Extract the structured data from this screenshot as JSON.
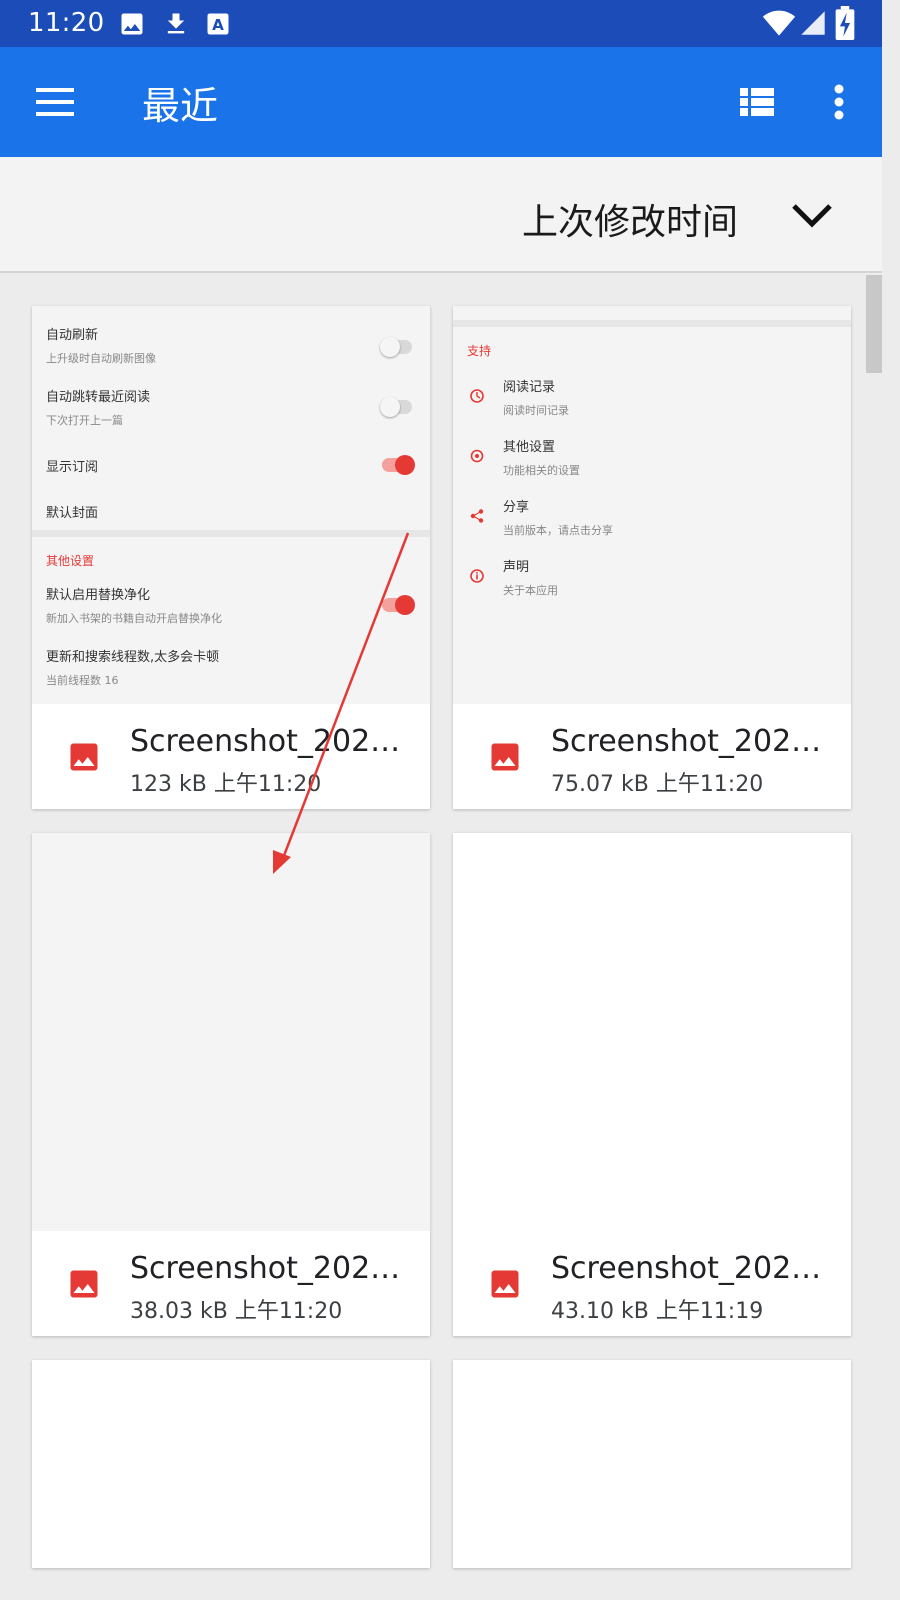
{
  "status_bar": {
    "time": "11:20",
    "left_icons": [
      "image-icon",
      "download-icon",
      "keyboard-a-icon"
    ],
    "right_icons": [
      "wifi-icon",
      "signal-icon",
      "battery-charging-icon"
    ]
  },
  "app_bar": {
    "title": "最近",
    "menu_icon": "hamburger-menu-icon",
    "view_icon": "list-view-icon",
    "more_icon": "more-vert-icon",
    "color": "#1a73e8"
  },
  "sort": {
    "label": "上次修改时间",
    "icon": "chevron-down-icon"
  },
  "files": [
    {
      "name": "Screenshot_2025…",
      "size": "123 kB",
      "time": "上午11:20"
    },
    {
      "name": "Screenshot_2025…",
      "size": "75.07 kB",
      "time": "上午11:20"
    },
    {
      "name": "Screenshot_2025…",
      "size": "38.03 kB",
      "time": "上午11:20"
    },
    {
      "name": "Screenshot_2025…",
      "size": "43.10 kB",
      "time": "上午11:19"
    }
  ],
  "thumb1": {
    "rows": [
      {
        "title": "自动刷新",
        "sub": "上升级时自动刷新图像"
      },
      {
        "title": "自动跳转最近阅读",
        "sub": "下次打开上一篇"
      },
      {
        "title": "显示订阅"
      },
      {
        "title": "默认封面"
      }
    ],
    "section": "其他设置",
    "rows2": [
      {
        "title": "默认启用替换净化",
        "sub": "新加入书架的书籍自动开启替换净化"
      },
      {
        "title": "更新和搜索线程数,太多会卡顿",
        "sub": "当前线程数 16"
      }
    ]
  },
  "thumb2": {
    "section": "支持",
    "items": [
      {
        "title": "阅读记录",
        "sub": "阅读时间记录"
      },
      {
        "title": "其他设置",
        "sub": "功能相关的设置"
      },
      {
        "title": "分享",
        "sub": "当前版本，请点击分享"
      },
      {
        "title": "声明",
        "sub": "关于本应用"
      }
    ]
  },
  "colors": {
    "status_bar": "#1b4cb7",
    "accent_red": "#e53935",
    "annotation_arrow": "#e53935"
  }
}
